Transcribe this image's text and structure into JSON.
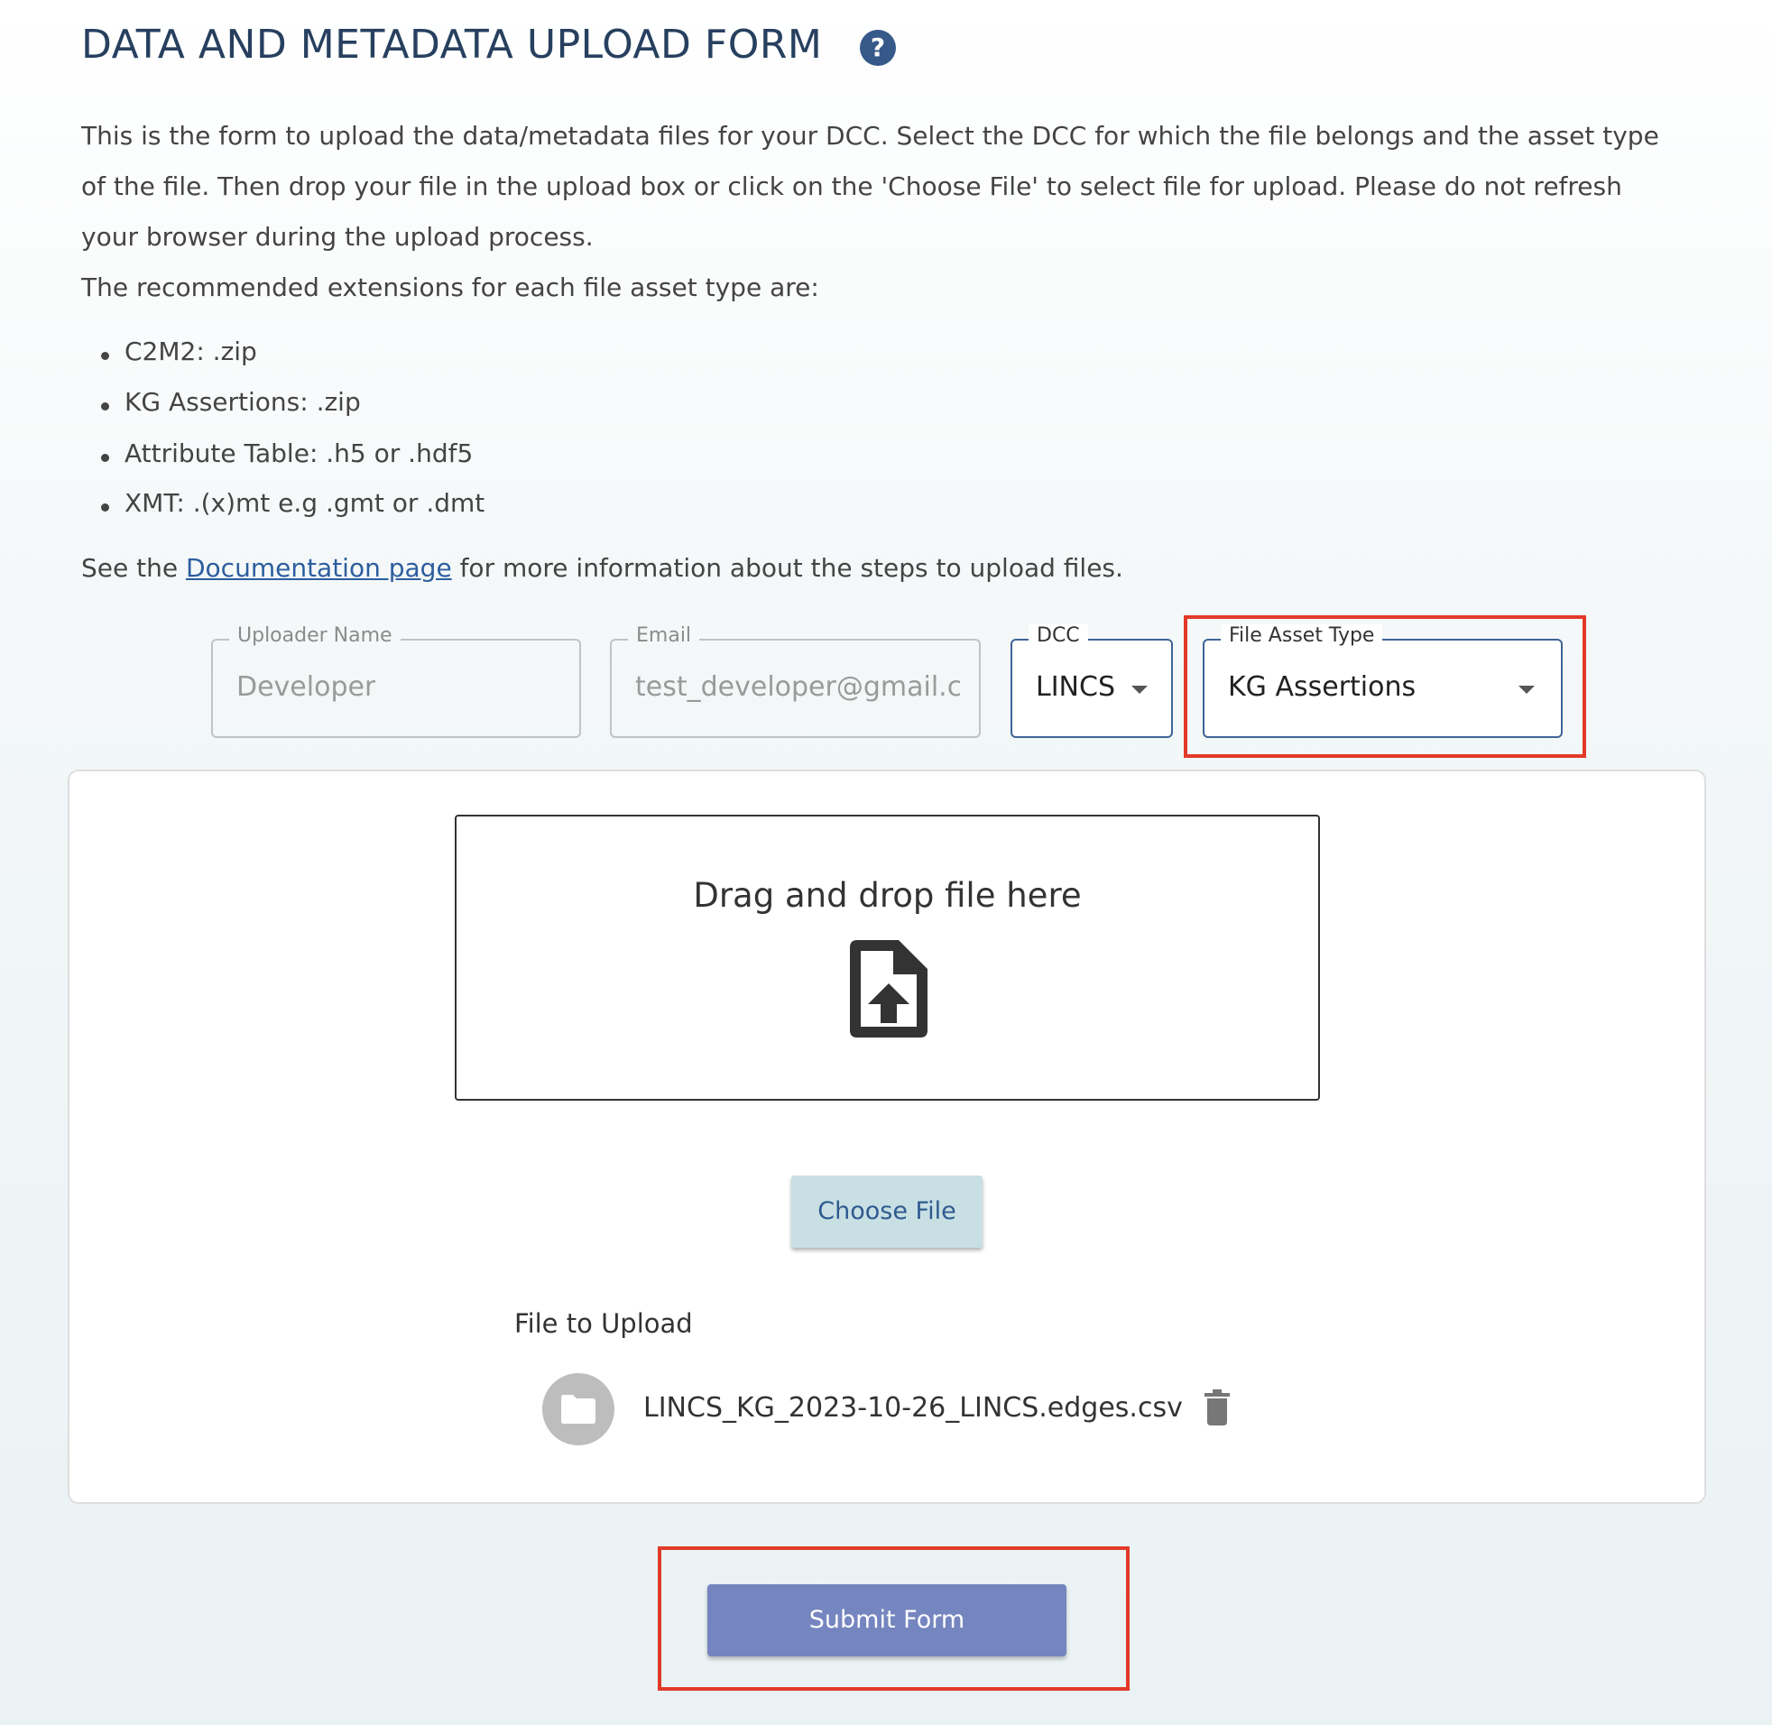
{
  "header": {
    "title": "DATA AND METADATA UPLOAD FORM",
    "help_icon": "question-circle-icon"
  },
  "intro": {
    "lines": [
      "This is the form to upload the data/metadata files for your DCC. Select the DCC for which the file belongs and the asset type",
      "of the file. Then drop your file in the upload box or click on the 'Choose File' to select file for upload. Please do not refresh",
      "your browser during the upload process.",
      "The recommended extensions for each file asset type are:"
    ],
    "extensions": [
      "C2M2: .zip",
      "KG Assertions: .zip",
      "Attribute Table: .h5 or .hdf5",
      "XMT: .(x)mt e.g .gmt or .dmt"
    ],
    "doc_prefix": "See the",
    "doc_link": "Documentation page",
    "doc_suffix": "for more information about the steps to upload files."
  },
  "form": {
    "uploader": {
      "label": "Uploader Name",
      "value": "Developer"
    },
    "email": {
      "label": "Email",
      "value": "test_developer@gmail.com"
    },
    "dcc": {
      "label": "DCC",
      "value": "LINCS"
    },
    "asset_type": {
      "label": "File Asset Type",
      "value": "KG Assertions"
    }
  },
  "upload": {
    "drop_text": "Drag and drop file here",
    "choose_label": "Choose File",
    "file_to_upload_label": "File to Upload",
    "file_name": "LINCS_KG_2023-10-26_LINCS.edges.csv"
  },
  "submit_label": "Submit Form",
  "colors": {
    "accent": "#27405f",
    "highlight": "#e23a28",
    "submit": "#7585bf",
    "choose": "#c8e0e4"
  }
}
